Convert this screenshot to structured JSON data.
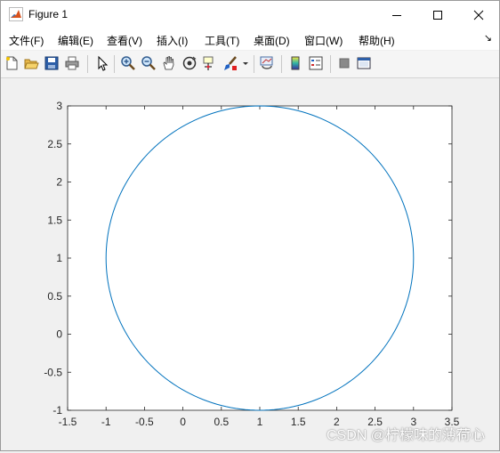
{
  "window": {
    "title": "Figure 1"
  },
  "menu": {
    "items": [
      "文件(F)",
      "编辑(E)",
      "查看(V)",
      "插入(I)",
      "工具(T)",
      "桌面(D)",
      "窗口(W)",
      "帮助(H)"
    ]
  },
  "toolbar": {
    "icons": [
      "new-figure-icon",
      "open-file-icon",
      "save-icon",
      "print-icon",
      "select-pointer-icon",
      "zoom-in-icon",
      "zoom-out-icon",
      "pan-icon",
      "rotate-3d-icon",
      "data-cursor-icon",
      "brush-icon",
      "brush-dropdown-icon",
      "link-plot-icon",
      "colorbar-icon",
      "legend-icon",
      "hide-plot-tools-icon",
      "show-plot-tools-icon"
    ]
  },
  "chart_data": {
    "type": "line",
    "title": "",
    "xlabel": "",
    "ylabel": "",
    "xlim": [
      -1.5,
      3.5
    ],
    "ylim": [
      -1,
      3
    ],
    "xticks": [
      "-1.5",
      "-1",
      "-0.5",
      "0",
      "0.5",
      "1",
      "1.5",
      "2",
      "2.5",
      "3",
      "3.5"
    ],
    "yticks": [
      "-1",
      "-0.5",
      "0",
      "0.5",
      "1",
      "1.5",
      "2",
      "2.5",
      "3"
    ],
    "grid": false,
    "series": [
      {
        "shape": "circle",
        "center": [
          1,
          1
        ],
        "radius": 2,
        "color": "#0072bd"
      }
    ]
  },
  "watermark": "CSDN @柠檬味的薄荷心"
}
